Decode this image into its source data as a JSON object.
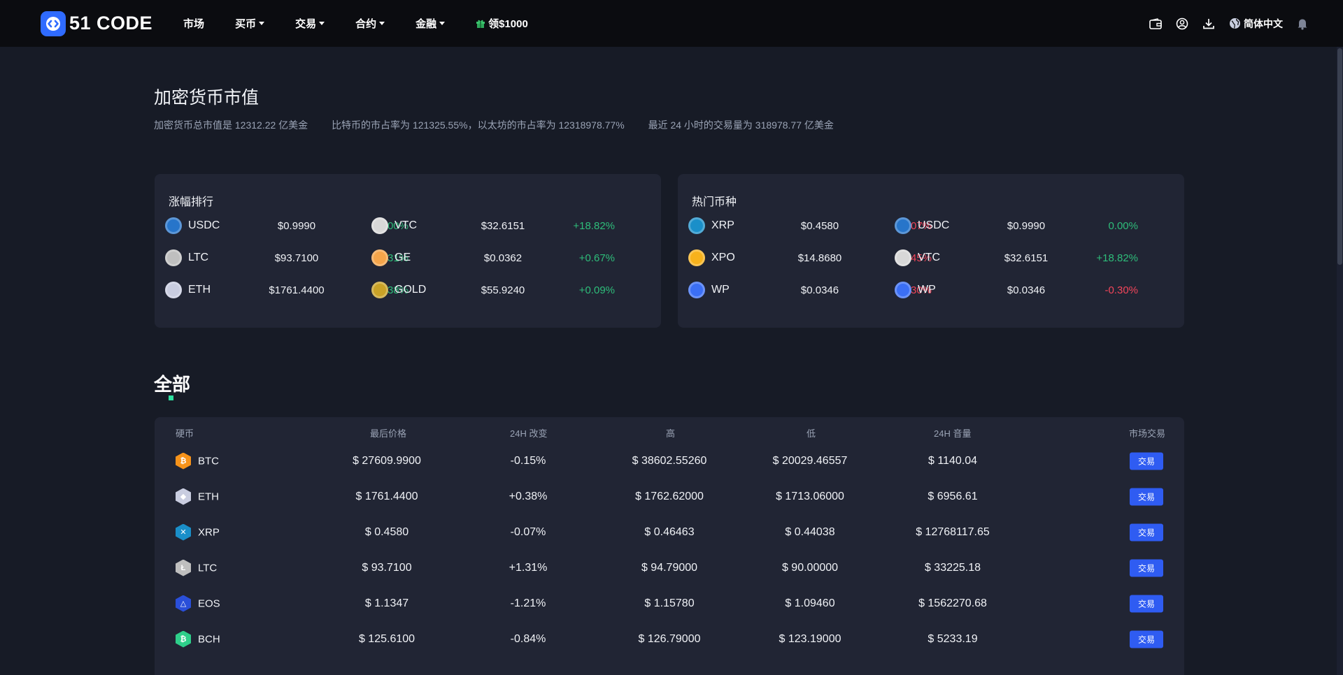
{
  "nav": {
    "brand": "51 CODE",
    "items": [
      {
        "label": "市场",
        "dropdown": false
      },
      {
        "label": "买币",
        "dropdown": true
      },
      {
        "label": "交易",
        "dropdown": true
      },
      {
        "label": "合约",
        "dropdown": true
      },
      {
        "label": "金融",
        "dropdown": true
      }
    ],
    "promo": "领$1000",
    "language": "简体中文",
    "icons": [
      "wallet-icon",
      "user-icon",
      "download-icon",
      "globe-icon",
      "bell-icon"
    ]
  },
  "header": {
    "title": "加密货币市值",
    "stats": [
      "加密货币总市值是 12312.22 亿美金",
      "比特币的市占率为 121325.55%，以太坊的市占率为 12318978.77%",
      "最近 24 小时的交易量为 318978.77 亿美金"
    ]
  },
  "gainers": {
    "title": "涨幅排行",
    "items": [
      {
        "name": "USDC",
        "price": "$0.9990",
        "change": "0.00%",
        "dir": "flat",
        "icon": "usdc-icon",
        "color": "#2775ca"
      },
      {
        "name": "VTC",
        "price": "$32.6151",
        "change": "+18.82%",
        "dir": "up",
        "icon": "vtc-icon",
        "color": "#d8d8d8"
      },
      {
        "name": "LTC",
        "price": "$93.7100",
        "change": "+1.31%",
        "dir": "up",
        "icon": "ltc-icon",
        "color": "#bfbfbf"
      },
      {
        "name": "GE",
        "price": "$0.0362",
        "change": "+0.67%",
        "dir": "up",
        "icon": "ge-icon",
        "color": "#f5a54a"
      },
      {
        "name": "ETH",
        "price": "$1761.4400",
        "change": "+0.38%",
        "dir": "up",
        "icon": "eth-icon",
        "color": "#c9cde0"
      },
      {
        "name": "GOLD",
        "price": "$55.9240",
        "change": "+0.09%",
        "dir": "up",
        "icon": "gold-icon",
        "color": "#c9a227"
      }
    ]
  },
  "hot": {
    "title": "热门币种",
    "items": [
      {
        "name": "XRP",
        "price": "$0.4580",
        "change": "-0.07%",
        "dir": "down",
        "icon": "xrp-icon",
        "color": "#1a8fc9"
      },
      {
        "name": "USDC",
        "price": "$0.9990",
        "change": "0.00%",
        "dir": "flat",
        "icon": "usdc-icon",
        "color": "#2775ca"
      },
      {
        "name": "XPO",
        "price": "$14.8680",
        "change": "-1.45%",
        "dir": "down",
        "icon": "xpo-icon",
        "color": "#f7b21c"
      },
      {
        "name": "VTC",
        "price": "$32.6151",
        "change": "+18.82%",
        "dir": "up",
        "icon": "vtc-icon",
        "color": "#d8d8d8"
      },
      {
        "name": "WP",
        "price": "$0.0346",
        "change": "-0.30%",
        "dir": "down",
        "icon": "wp-icon",
        "color": "#3b6ff5"
      },
      {
        "name": "WP",
        "price": "$0.0346",
        "change": "-0.30%",
        "dir": "down",
        "icon": "wp-icon",
        "color": "#3b6ff5"
      }
    ]
  },
  "all": {
    "title": "全部",
    "columns": [
      "硬币",
      "最后价格",
      "24H 改变",
      "高",
      "低",
      "24H 音量",
      "市场交易"
    ],
    "trade_label": "交易",
    "rows": [
      {
        "coin": "BTC",
        "price": "$ 27609.9900",
        "change": "-0.15%",
        "dir": "down",
        "high": "$ 38602.55260",
        "low": "$ 20029.46557",
        "volume": "$ 1140.04",
        "icon": "btc-icon",
        "color": "#f7931a",
        "glyph": "₿"
      },
      {
        "coin": "ETH",
        "price": "$ 1761.4400",
        "change": "+0.38%",
        "dir": "up",
        "high": "$ 1762.62000",
        "low": "$ 1713.06000",
        "volume": "$ 6956.61",
        "icon": "eth-icon",
        "color": "#c9cde0",
        "glyph": "◆"
      },
      {
        "coin": "XRP",
        "price": "$ 0.4580",
        "change": "-0.07%",
        "dir": "down",
        "high": "$ 0.46463",
        "low": "$ 0.44038",
        "volume": "$ 12768117.65",
        "icon": "xrp-icon",
        "color": "#1a8fc9",
        "glyph": "✕"
      },
      {
        "coin": "LTC",
        "price": "$ 93.7100",
        "change": "+1.31%",
        "dir": "up",
        "high": "$ 94.79000",
        "low": "$ 90.00000",
        "volume": "$ 33225.18",
        "icon": "ltc-icon",
        "color": "#bfbfbf",
        "glyph": "Ł"
      },
      {
        "coin": "EOS",
        "price": "$ 1.1347",
        "change": "-1.21%",
        "dir": "down",
        "high": "$ 1.15780",
        "low": "$ 1.09460",
        "volume": "$ 1562270.68",
        "icon": "eos-icon",
        "color": "#2a4fd9",
        "glyph": "△"
      },
      {
        "coin": "BCH",
        "price": "$ 125.6100",
        "change": "-0.84%",
        "dir": "down",
        "high": "$ 126.79000",
        "low": "$ 123.19000",
        "volume": "$ 5233.19",
        "icon": "bch-icon",
        "color": "#2ecf8a",
        "glyph": "₿"
      }
    ]
  }
}
